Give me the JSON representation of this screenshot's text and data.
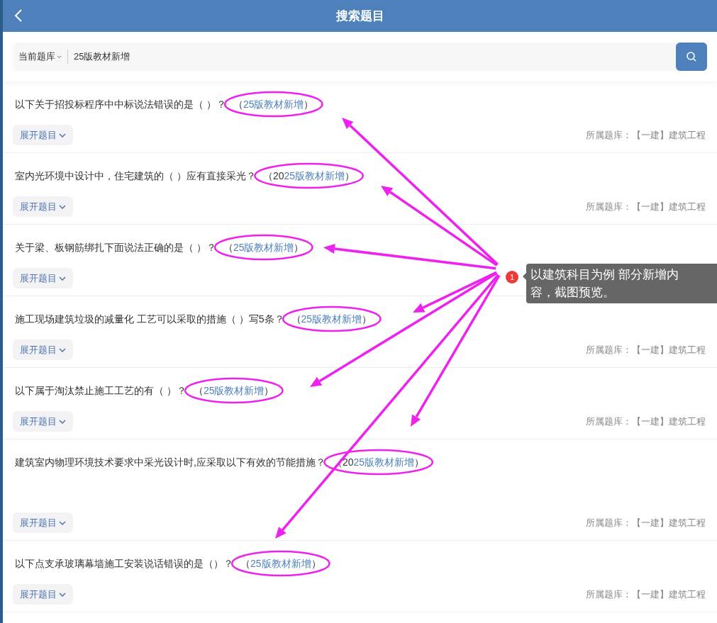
{
  "header": {
    "title": "搜索题目"
  },
  "search": {
    "scope": "当前题库",
    "value": "25版教材新增"
  },
  "questions": [
    {
      "kind": "short",
      "text": "以下关于招投标程序中中标说法错误的是（ ）？",
      "tag": {
        "prefix": "（",
        "highlight": "25版教材新增",
        "suffix": "）"
      },
      "expand": "展开题目",
      "source": "所属题库：【一建】建筑工程"
    },
    {
      "kind": "short",
      "text": "室内光环境中设计中，住宅建筑的（ ）应有直接采光？",
      "tag": {
        "prefix": "（20",
        "highlight": "25版教材新增",
        "suffix": "）"
      },
      "expand": "展开题目",
      "source": "所属题库：【一建】建筑工程"
    },
    {
      "kind": "short",
      "text": "关于梁、板钢筋绑扎下面说法正确的是（ ）？",
      "tag": {
        "prefix": "（",
        "highlight": "25版教材新增",
        "suffix": "）"
      },
      "expand": "展开题目"
    },
    {
      "kind": "short",
      "text": "施工现场建筑垃圾的减量化 工艺可以采取的措施（ ）写5条？",
      "tag": {
        "prefix": "（",
        "highlight": "25版教材新增",
        "suffix": "）"
      },
      "expand": "展开题目",
      "source": "所属题库：【一建】建筑工程"
    },
    {
      "kind": "short",
      "text": "以下属于淘汰禁止施工工艺的有（ ）？",
      "tag": {
        "prefix": "（",
        "highlight": "25版教材新增",
        "suffix": "）"
      },
      "expand": "展开题目",
      "source": "所属题库：【一建】建筑工程"
    },
    {
      "kind": "long",
      "text": "建筑室内物理环境技术要求中采光设计时,应采取以下有效的节能措施？",
      "tag": {
        "prefix": "（20",
        "highlight": "25版教材新增",
        "suffix": "）"
      },
      "expand": "展开题目",
      "source": "所属题库：【一建】建筑工程"
    },
    {
      "kind": "short",
      "text": "以下点支承玻璃幕墙施工安装说话错误的是（）？",
      "tag": {
        "prefix": "（",
        "highlight": "25版教材新增",
        "suffix": "）"
      },
      "expand": "展开题目",
      "source": "所属题库：【一建】建筑工程"
    }
  ],
  "annotation": {
    "badge": "1",
    "note": "以建筑科目为例 部分新增内容，截图预览。"
  }
}
